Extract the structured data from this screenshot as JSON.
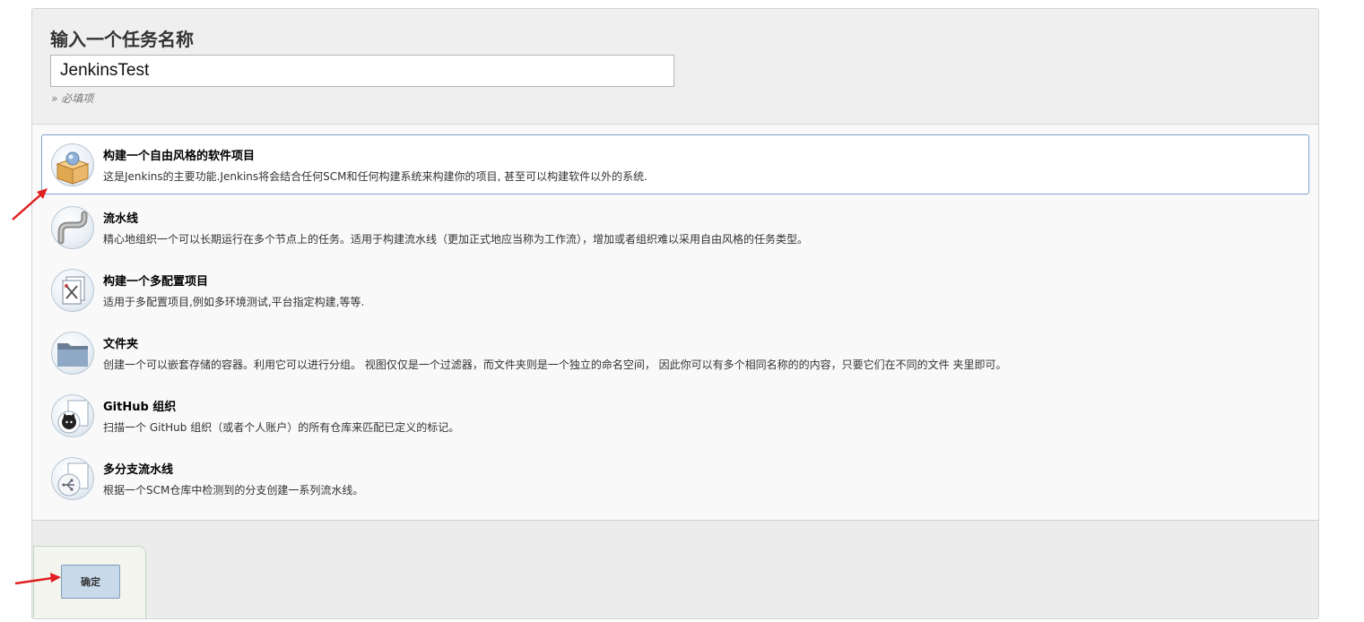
{
  "header": {
    "title": "输入一个任务名称",
    "task_name_value": "JenkinsTest",
    "required_hint": "» 必填项"
  },
  "items": [
    {
      "title": "构建一个自由风格的软件项目",
      "desc": "这是Jenkins的主要功能.Jenkins将会结合任何SCM和任何构建系统来构建你的项目, 甚至可以构建软件以外的系统.",
      "icon": "freestyle-box-icon",
      "selected": true
    },
    {
      "title": "流水线",
      "desc": "精心地组织一个可以长期运行在多个节点上的任务。适用于构建流水线（更加正式地应当称为工作流），增加或者组织难以采用自由风格的任务类型。",
      "icon": "pipeline-icon",
      "selected": false
    },
    {
      "title": "构建一个多配置项目",
      "desc": "适用于多配置项目,例如多环境测试,平台指定构建,等等.",
      "icon": "multi-config-icon",
      "selected": false
    },
    {
      "title": "文件夹",
      "desc": "创建一个可以嵌套存储的容器。利用它可以进行分组。 视图仅仅是一个过滤器，而文件夹则是一个独立的命名空间， 因此你可以有多个相同名称的的内容，只要它们在不同的文件 夹里即可。",
      "icon": "folder-icon",
      "selected": false
    },
    {
      "title": "GitHub 组织",
      "desc": "扫描一个 GitHub 组织（或者个人账户）的所有仓库来匹配已定义的标记。",
      "icon": "github-icon",
      "selected": false
    },
    {
      "title": "多分支流水线",
      "desc": "根据一个SCM仓库中检测到的分支创建一系列流水线。",
      "icon": "multibranch-icon",
      "selected": false
    }
  ],
  "footer": {
    "ok_label": "确定"
  },
  "colors": {
    "selected_border": "#7ea4cf",
    "annotation_arrow": "#e02020",
    "button_bg": "#c8d9ea"
  }
}
